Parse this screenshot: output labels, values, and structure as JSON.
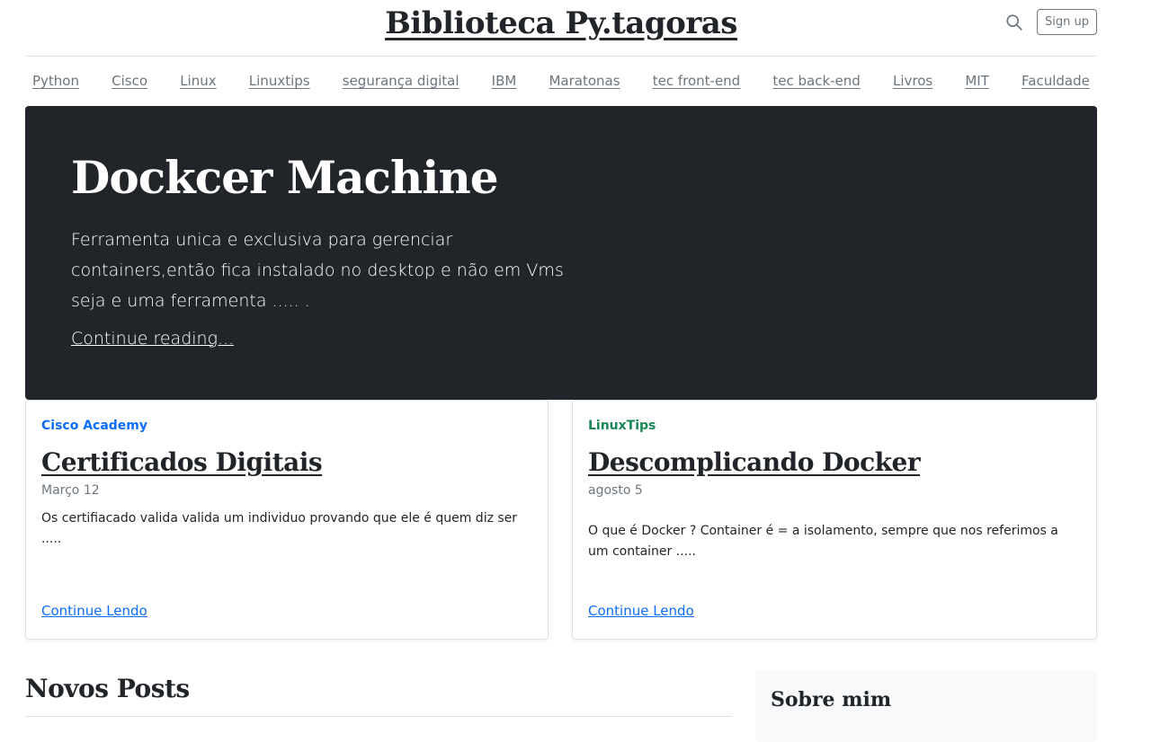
{
  "header": {
    "site_title": "Biblioteca Py.tagoras",
    "signup_label": "Sign up"
  },
  "nav": {
    "items": [
      "Python",
      "Cisco",
      "Linux",
      "Linuxtips",
      "segurança digital",
      "IBM",
      "Maratonas",
      "tec front-end",
      "tec back-end",
      "Livros",
      "MIT",
      "Faculdade"
    ]
  },
  "hero": {
    "title": "Dockcer Machine",
    "lead": "Ferramenta unica e exclusiva para gerenciar containers,então fica instalado no desktop e não em Vms seja e uma ferramenta ..... .",
    "link": "Continue reading..."
  },
  "cards": [
    {
      "category": "Cisco Academy",
      "category_color": "#0d6efd",
      "title": "Certificados Digitais",
      "date": "Março 12",
      "text": "Os certifiacado valida valida um individuo provando que ele é quem diz ser .....",
      "link": "Continue Lendo"
    },
    {
      "category": "LinuxTips",
      "category_color": "#198754",
      "title": "Descomplicando Docker",
      "date": "agosto 5",
      "text": "O que é Docker ? Container é = a isolamento, sempre que nos referimos a um container .....",
      "link": "Continue Lendo"
    }
  ],
  "main": {
    "section_title": "Novos Posts"
  },
  "sidebar": {
    "title": "Sobre mim"
  },
  "colors": {
    "hero_bg": "#212529",
    "link_blue": "#0d6efd",
    "muted": "#6c757d"
  }
}
